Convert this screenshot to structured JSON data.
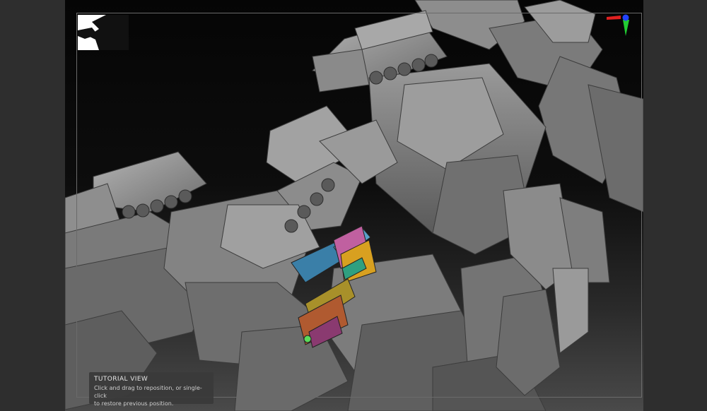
{
  "tutorial": {
    "title": "TUTORIAL VIEW",
    "line1": "Click and drag to reposition, or single-click",
    "line2": "to restore previous position."
  },
  "icons": {
    "gizmo": "axis-gizmo-icon",
    "thumbnail": "silhouette-thumbnail"
  },
  "colors": {
    "axis_x": "#e02020",
    "axis_y": "#22cc33",
    "axis_z": "#2244ff"
  }
}
